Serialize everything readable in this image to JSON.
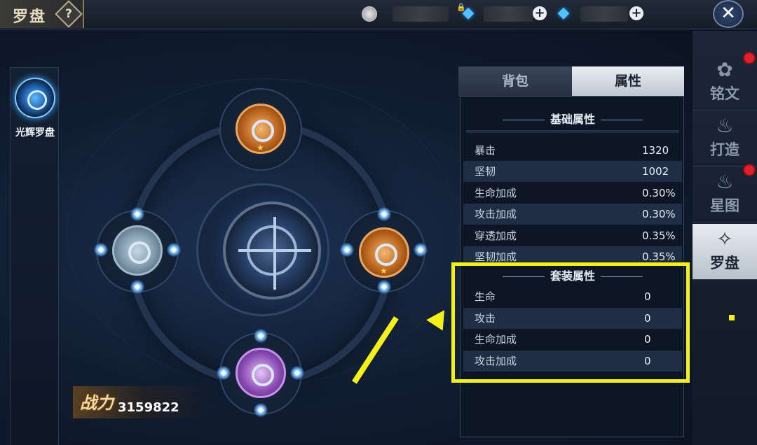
{
  "header": {
    "title": "罗盘",
    "help_glyph": "?",
    "close_glyph": "✕",
    "plus_glyph": "+",
    "gem_glyph": "◆",
    "lock_glyph": "🔒"
  },
  "left_panel": {
    "items": [
      {
        "label": "光辉罗盘"
      }
    ]
  },
  "power": {
    "label": "战力",
    "value": "3159822"
  },
  "attr_panel": {
    "tabs": [
      {
        "label": "背包"
      },
      {
        "label": "属性"
      }
    ],
    "basic": {
      "title": "基础属性",
      "rows": [
        {
          "name": "暴击",
          "value": "1320"
        },
        {
          "name": "坚韧",
          "value": "1002"
        },
        {
          "name": "生命加成",
          "value": "0.30%"
        },
        {
          "name": "攻击加成",
          "value": "0.30%"
        },
        {
          "name": "穿透加成",
          "value": "0.35%"
        },
        {
          "name": "坚韧加成",
          "value": "0.35%"
        }
      ]
    },
    "set": {
      "title": "套装属性",
      "rows": [
        {
          "name": "生命",
          "value": "0"
        },
        {
          "name": "攻击",
          "value": "0"
        },
        {
          "name": "生命加成",
          "value": "0"
        },
        {
          "name": "攻击加成",
          "value": "0"
        }
      ]
    }
  },
  "side_tabs": [
    {
      "label": "铭文",
      "icon": "inscription-icon",
      "glyph": "✿",
      "badge": true
    },
    {
      "label": "打造",
      "icon": "forge-flame-icon",
      "glyph": "♨",
      "badge": false
    },
    {
      "label": "星图",
      "icon": "star-chart-flame-icon",
      "glyph": "♨",
      "badge": true
    },
    {
      "label": "罗盘",
      "icon": "compass-icon",
      "glyph": "✧",
      "badge": false
    }
  ],
  "colors": {
    "highlight": "#f5ef1a",
    "badge": "#e0202a",
    "gem": "#4fc3ff"
  }
}
